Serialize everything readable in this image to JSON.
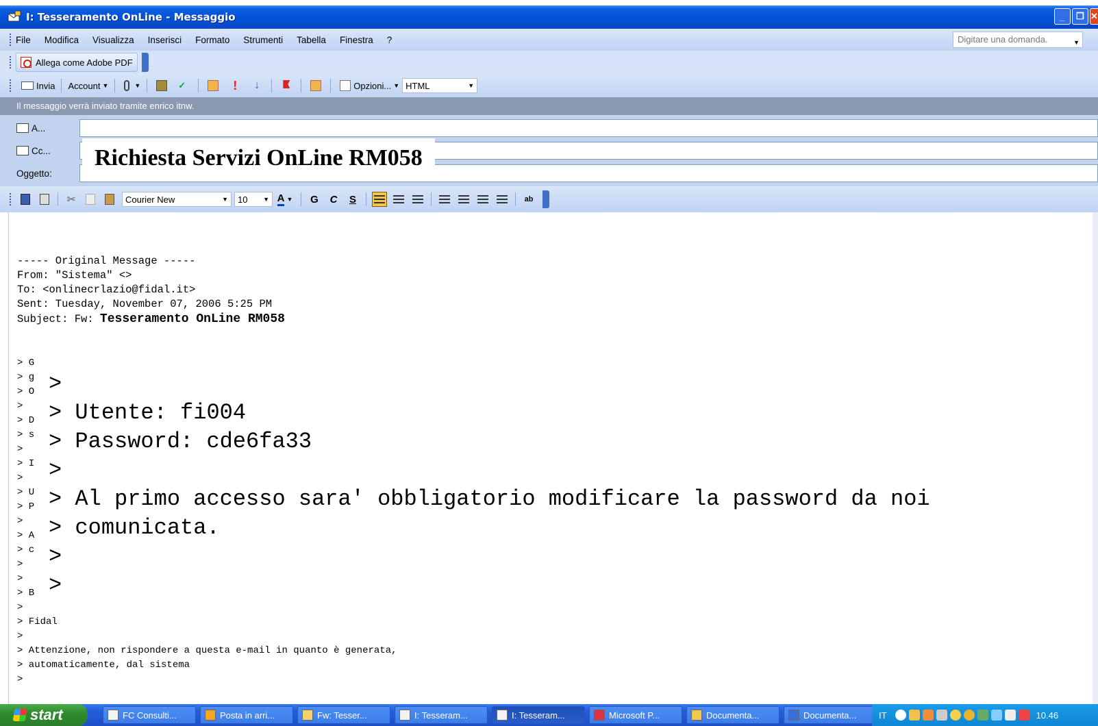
{
  "window": {
    "title": "I: Tesseramento OnLine - Messaggio"
  },
  "menubar": {
    "items": [
      "File",
      "Modifica",
      "Visualizza",
      "Inserisci",
      "Formato",
      "Strumenti",
      "Tabella",
      "Finestra",
      "?"
    ],
    "question_placeholder": "Digitare una domanda."
  },
  "pdfbar": {
    "label": "Allega come Adobe PDF"
  },
  "sendbar": {
    "send": "Invia",
    "account": "Account",
    "options": "Opzioni...",
    "format": "HTML"
  },
  "info": "Il messaggio verrà inviato tramite enrico itnw.",
  "headers": {
    "to_label": "A...",
    "cc_label": "Cc...",
    "subject_label": "Oggetto:",
    "subject_value": "Richiesta Servizi OnLine RM058"
  },
  "format": {
    "font": "Courier New",
    "size": "10",
    "bold": "G",
    "italic": "C",
    "underline": "S"
  },
  "message": {
    "original_header": "----- Original Message -----",
    "from": "From: \"Sistema\" <>",
    "to": "To: <onlinecrlazio@fidal.it>",
    "sent": "Sent: Tuesday, November 07, 2006 5:25 PM",
    "subject_prefix": "Subject: Fw: ",
    "subject_title": "Tesseramento OnLine RM058",
    "quote_letters": [
      "> G",
      "> g",
      "> O",
      ">",
      "> D",
      "> s",
      ">",
      "> I",
      ">",
      "> U",
      "> P",
      ">",
      "> A",
      "> c",
      ">",
      ">",
      "> B"
    ],
    "big_lines": [
      ">",
      "> Utente: fi004",
      "> Password: cde6fa33",
      ">",
      "> Al primo accesso sara' obbligatorio modificare la password da noi",
      "> comunicata.",
      ">",
      ">"
    ],
    "tail": [
      ">",
      "> Fidal",
      ">",
      "> Attenzione, non rispondere a questa e-mail in quanto è generata,",
      "> automaticamente, dal sistema",
      ">"
    ]
  },
  "taskbar": {
    "start": "start",
    "tasks": [
      "FC Consulti...",
      "Posta in arri...",
      "Fw: Tesser...",
      "I: Tesseram...",
      "I: Tesseram...",
      "Microsoft P...",
      "Documenta...",
      "Documenta..."
    ],
    "lang": "IT",
    "clock": "10.46"
  }
}
